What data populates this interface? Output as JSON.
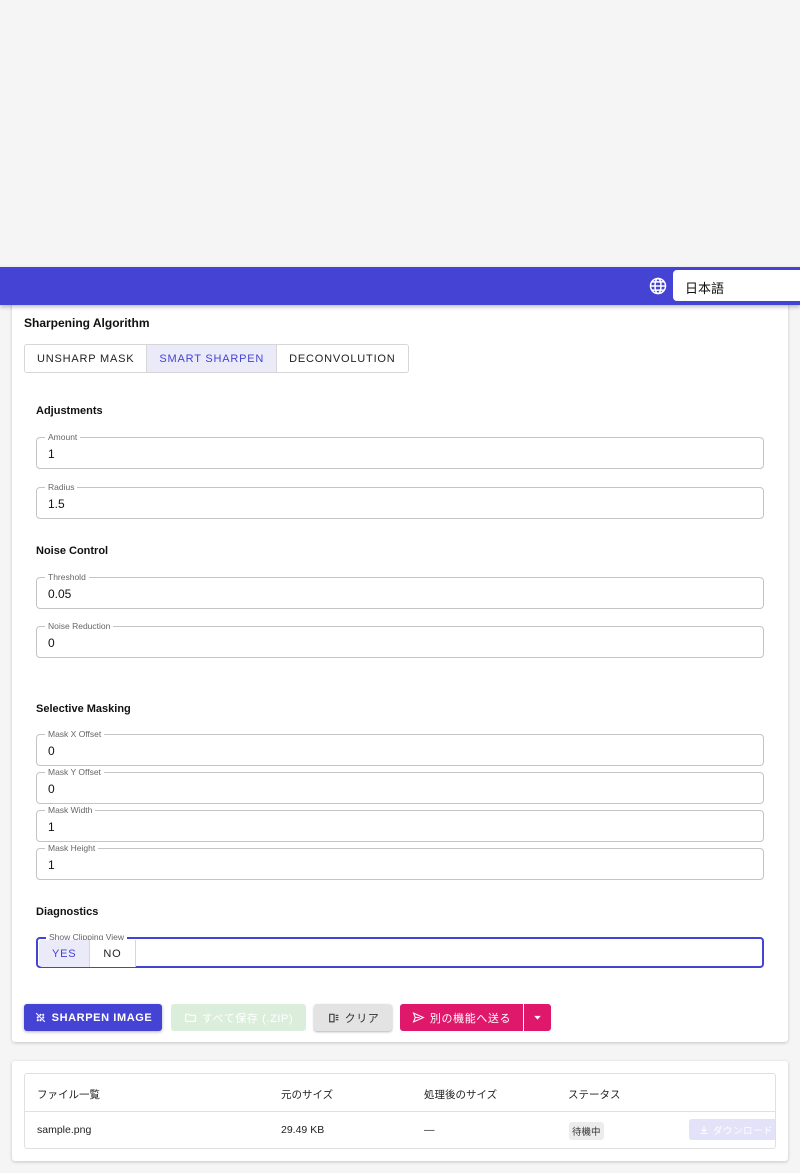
{
  "header": {
    "language": "日本語",
    "icon": "globe-icon",
    "color": "#4443d4"
  },
  "algorithm": {
    "heading": "Sharpening Algorithm",
    "options": [
      "UNSHARP MASK",
      "SMART SHARPEN",
      "DECONVOLUTION"
    ],
    "selected": "SMART SHARPEN"
  },
  "adjustments": {
    "heading": "Adjustments",
    "amount": {
      "label": "Amount",
      "value": "1"
    },
    "radius": {
      "label": "Radius",
      "value": "1.5"
    }
  },
  "noise": {
    "heading": "Noise Control",
    "threshold": {
      "label": "Threshold",
      "value": "0.05"
    },
    "reduction": {
      "label": "Noise Reduction",
      "value": "0"
    }
  },
  "masking": {
    "heading": "Selective Masking",
    "x_offset": {
      "label": "Mask X Offset",
      "value": "0"
    },
    "y_offset": {
      "label": "Mask Y Offset",
      "value": "0"
    },
    "width": {
      "label": "Mask Width",
      "value": "1"
    },
    "height": {
      "label": "Mask Height",
      "value": "1"
    }
  },
  "diagnostics": {
    "heading": "Diagnostics",
    "clipping": {
      "label": "Show Clipping View",
      "yes": "YES",
      "no": "NO",
      "selected": "YES"
    }
  },
  "actions": {
    "sharpen": "SHARPEN IMAGE",
    "save_zip": "すべて保存 (.ZIP)",
    "clear": "クリア",
    "send": "別の機能へ送る"
  },
  "files": {
    "headers": [
      "ファイル一覧",
      "元のサイズ",
      "処理後のサイズ",
      "ステータス"
    ],
    "rows": [
      {
        "name": "sample.png",
        "original": "29.49 KB",
        "processed": "—",
        "status": "待機中",
        "download": "ダウンロード"
      }
    ]
  }
}
